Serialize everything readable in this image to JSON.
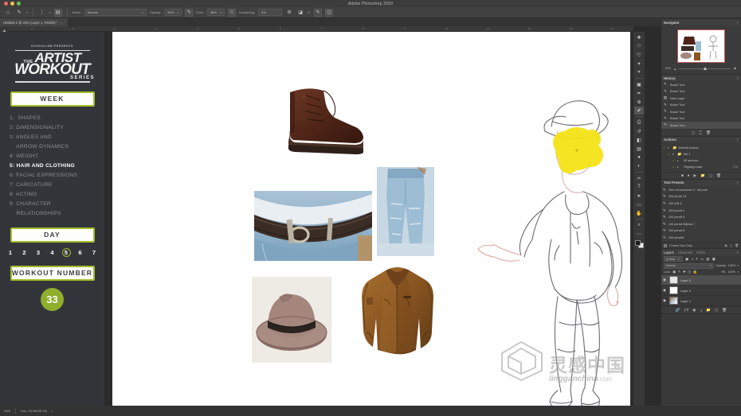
{
  "window": {
    "app_title": "Adobe Photoshop 2020",
    "traffic_lights": [
      "close",
      "minimize",
      "zoom"
    ]
  },
  "options_bar": {
    "home_icon": "home-icon",
    "tool_icon": "brush-tool-icon",
    "tool_caret": "▾",
    "brush_size_caret": "▾",
    "toggle_brush_panel": "brush-panel-icon",
    "mode_label": "Mode:",
    "mode_value": "Normal",
    "mode_caret": "▾",
    "opacity_label": "Opacity:",
    "opacity_value": "50%",
    "opacity_caret": "▾",
    "pressure_opacity_icon": "pressure-opacity-icon",
    "flow_label": "Flow:",
    "flow_value": "38%",
    "flow_caret": "▾",
    "airbrush_icon": "airbrush-icon",
    "smoothing_label": "Smoothing:",
    "smoothing_value": "0%",
    "smoothing_gear": "gear-icon",
    "angle_icon": "brush-angle-icon",
    "angle_value": "0°",
    "symmetry_icon": "symmetry-icon",
    "pressure_size_icon": "pressure-size-icon",
    "tablet_icon": "tablet-pressure-icon"
  },
  "document_tab": {
    "label": "Untitled-1 @ 33% (Layer 1, RGB/8) *",
    "close": "×"
  },
  "rulers": {
    "horizontal_ticks": [
      "0",
      "1",
      "2",
      "3",
      "4",
      "5",
      "6",
      "7",
      "8",
      "9",
      "10",
      "11",
      "12",
      "13",
      "14"
    ],
    "vertical_ticks": [
      "0",
      "1",
      "2",
      "3",
      "4",
      "5",
      "6",
      "7",
      "8"
    ]
  },
  "left_toolbar": {
    "items": [
      {
        "name": "move-tool",
        "glyph": "✚",
        "selected": false
      },
      {
        "name": "marquee-tool",
        "glyph": "□",
        "selected": false
      },
      {
        "name": "lasso-tool",
        "glyph": "➰",
        "selected": false
      },
      {
        "name": "quick-select-tool",
        "glyph": "✦",
        "selected": false
      },
      {
        "name": "crop-tool",
        "glyph": "⌗",
        "selected": false
      },
      {
        "name": "eyedropper-tool",
        "glyph": "✒",
        "selected": false
      },
      {
        "name": "healing-brush-tool",
        "glyph": "⊕",
        "selected": false
      },
      {
        "name": "brush-tool",
        "glyph": "✐",
        "selected": true
      },
      {
        "name": "clone-stamp-tool",
        "glyph": "⎙",
        "selected": false
      },
      {
        "name": "history-brush-tool",
        "glyph": "↺",
        "selected": false
      },
      {
        "name": "eraser-tool",
        "glyph": "◧",
        "selected": false
      },
      {
        "name": "gradient-tool",
        "glyph": "▤",
        "selected": false
      },
      {
        "name": "blur-tool",
        "glyph": "●",
        "selected": false
      },
      {
        "name": "dodge-tool",
        "glyph": "◐",
        "selected": false
      },
      {
        "name": "pen-tool",
        "glyph": "✑",
        "selected": false
      },
      {
        "name": "type-tool",
        "glyph": "T",
        "selected": false
      },
      {
        "name": "path-select-tool",
        "glyph": "➤",
        "selected": false
      },
      {
        "name": "shape-tool",
        "glyph": "▭",
        "selected": false
      },
      {
        "name": "hand-tool",
        "glyph": "✋",
        "selected": false
      },
      {
        "name": "zoom-tool",
        "glyph": "⌕",
        "selected": false
      }
    ]
  },
  "right_toolbar": {
    "items": [
      {
        "name": "move-tool",
        "glyph": "✚",
        "selected": false
      },
      {
        "name": "marquee-tool",
        "glyph": "□",
        "selected": false
      },
      {
        "name": "lasso-tool",
        "glyph": "➰",
        "selected": false
      },
      {
        "name": "quick-select-tool",
        "glyph": "✦",
        "selected": false
      },
      {
        "name": "crop-tool",
        "glyph": "⌗",
        "selected": false
      },
      {
        "name": "frame-tool",
        "glyph": "▣",
        "selected": false
      },
      {
        "name": "eyedropper-tool",
        "glyph": "✒",
        "selected": false
      },
      {
        "name": "healing-brush-tool",
        "glyph": "⊕",
        "selected": false
      },
      {
        "name": "brush-tool",
        "glyph": "✐",
        "selected": true
      },
      {
        "name": "clone-stamp-tool",
        "glyph": "⎙",
        "selected": false
      },
      {
        "name": "history-brush-tool",
        "glyph": "↺",
        "selected": false
      },
      {
        "name": "eraser-tool",
        "glyph": "◧",
        "selected": false
      },
      {
        "name": "gradient-tool",
        "glyph": "▤",
        "selected": false
      },
      {
        "name": "blur-tool",
        "glyph": "●",
        "selected": false
      },
      {
        "name": "dodge-tool",
        "glyph": "◐",
        "selected": false
      },
      {
        "name": "pen-tool",
        "glyph": "✑",
        "selected": false
      },
      {
        "name": "type-tool",
        "glyph": "T",
        "selected": false
      },
      {
        "name": "path-select-tool",
        "glyph": "➤",
        "selected": false
      },
      {
        "name": "shape-tool",
        "glyph": "▭",
        "selected": false
      },
      {
        "name": "hand-tool",
        "glyph": "✋",
        "selected": false
      },
      {
        "name": "zoom-tool",
        "glyph": "⌕",
        "selected": false
      },
      {
        "name": "edit-toolbar",
        "glyph": "⋯",
        "selected": false
      }
    ],
    "foreground_color": "#1a1a1a",
    "background_color": "#f2f2f2"
  },
  "poster": {
    "presents_text": "SCHOOLISM       PRESENTS",
    "logo_the": "THE",
    "logo_artist": "ARTIST",
    "logo_workout": "WORKOUT",
    "logo_series": "SERIES",
    "week_button": "WEEK",
    "week_items": [
      {
        "label": "1:  SHAPES",
        "active": false
      },
      {
        "label": "2: DIMENSIONALITY",
        "active": false
      },
      {
        "label": "3: ANGLES AND",
        "active": false
      },
      {
        "label": "    ARROW DYNAMICS",
        "active": false
      },
      {
        "label": "4: WEIGHT",
        "active": false
      },
      {
        "label": "5: HAIR AND CLOTHING",
        "active": true
      },
      {
        "label": "6: FACIAL EXPRESSIONS",
        "active": false
      },
      {
        "label": "7: CARICATURE",
        "active": false
      },
      {
        "label": "8: ACTING",
        "active": false
      },
      {
        "label": "9: CHARACTER",
        "active": false
      },
      {
        "label": "    RELATIONSHIPS",
        "active": false
      }
    ],
    "day_button": "DAY",
    "days": [
      "1",
      "2",
      "3",
      "4",
      "5",
      "6",
      "7"
    ],
    "selected_day": "5",
    "workout_button": "WORKOUT NUMBER",
    "workout_number": "33",
    "accent_color": "#9fbd2a",
    "background_color": "#32363a"
  },
  "canvas": {
    "reference_photos": [
      {
        "name": "reference-photo-boot",
        "subject": "brown leather ankle boot"
      },
      {
        "name": "reference-photo-belt",
        "subject": "leather belt on blue jeans"
      },
      {
        "name": "reference-photo-jeans",
        "subject": "ripped light blue jeans"
      },
      {
        "name": "reference-photo-hat",
        "subject": "brown fedora hat"
      },
      {
        "name": "reference-photo-jacket",
        "subject": "brown leather jacket"
      }
    ],
    "sketch": {
      "name": "character-sketch",
      "subject": "pencil sketch of man in fedora and jacket"
    },
    "watermark_cn": "灵感中国",
    "watermark_en": "lingganchina",
    "watermark_tld": ".com"
  },
  "navigator": {
    "title": "Navigator",
    "zoom_value": "33%",
    "menu_icon": "≡"
  },
  "history": {
    "title": "History",
    "menu_icon": "≡",
    "items": [
      {
        "label": "Brush Tool",
        "icon": "brush-icon",
        "selected": false
      },
      {
        "label": "Brush Tool",
        "icon": "brush-icon",
        "selected": false
      },
      {
        "label": "New Layer",
        "icon": "layer-icon",
        "selected": false
      },
      {
        "label": "Brush Tool",
        "icon": "brush-icon",
        "selected": false
      },
      {
        "label": "Brush Tool",
        "icon": "brush-icon",
        "selected": false
      },
      {
        "label": "Brush Tool",
        "icon": "brush-icon",
        "selected": false
      },
      {
        "label": "Brush Tool",
        "icon": "brush-icon",
        "selected": true
      }
    ],
    "footer_icons": [
      "snapshot-icon",
      "new-document-icon",
      "delete-icon"
    ]
  },
  "actions": {
    "title": "Actions",
    "menu_icon": "≡",
    "items": [
      {
        "label": "Default Actions",
        "key": "",
        "icon": "folder-icon",
        "depth": 0
      },
      {
        "label": "Set 1",
        "key": "",
        "icon": "folder-icon",
        "depth": 1
      },
      {
        "label": "90 sec/min",
        "key": "",
        "icon": "action-icon",
        "depth": 2
      },
      {
        "label": "Flipping mask",
        "key": "F10",
        "icon": "action-icon",
        "depth": 2
      }
    ],
    "footer_icons": [
      "stop-icon",
      "record-icon",
      "play-icon",
      "folder-icon",
      "new-action-icon",
      "delete-icon"
    ]
  },
  "tool_presets": {
    "title": "Tool Presets",
    "menu_icon": "≡",
    "items": [
      {
        "label": "100 x brush/circle 3  - 48 pure",
        "icon": "brush-icon"
      },
      {
        "label": "100 pencil 14",
        "icon": "brush-icon"
      },
      {
        "label": "100 A/B 5",
        "icon": "brush-icon"
      },
      {
        "label": "100 pencil x",
        "icon": "brush-icon"
      },
      {
        "label": "100 pencil 6",
        "icon": "brush-icon"
      },
      {
        "label": "100 pencil Billows 7",
        "icon": "brush-icon"
      },
      {
        "label": "100 pencil 8",
        "icon": "brush-icon"
      },
      {
        "label": "100 pencil6",
        "icon": "brush-icon"
      }
    ],
    "current_tool_only": "Current Tool Only",
    "footer_icons": [
      "list-view-icon",
      "new-preset-icon",
      "delete-icon"
    ]
  },
  "layers": {
    "tabs": [
      {
        "label": "Layers",
        "active": true
      },
      {
        "label": "Channels",
        "active": false
      },
      {
        "label": "Paths",
        "active": false
      }
    ],
    "menu_icon": "≡",
    "filter_kind": "Q Kind",
    "filter_caret": "▾",
    "filter_icons": [
      "pixel-filter-icon",
      "adjustment-filter-icon",
      "type-filter-icon",
      "shape-filter-icon",
      "smart-filter-icon"
    ],
    "blend_mode": "Normal",
    "blend_caret": "▾",
    "opacity_label": "Opacity:",
    "opacity_value": "100%",
    "lock_label": "Lock:",
    "lock_icons": [
      "lock-transparency-icon",
      "lock-image-icon",
      "lock-position-icon",
      "lock-artboard-icon",
      "lock-all-icon"
    ],
    "fill_label": "Fill:",
    "fill_value": "100%",
    "rows": [
      {
        "name": "Layer 3",
        "visible": true,
        "selected": true,
        "thumb": "checker"
      },
      {
        "name": "Layer 2",
        "visible": true,
        "selected": false,
        "thumb": "white"
      },
      {
        "name": "Layer 1",
        "visible": true,
        "selected": false,
        "thumb": "image"
      }
    ],
    "footer_icons": [
      "link-icon",
      "fx-icon",
      "mask-icon",
      "adjustment-icon",
      "group-icon",
      "new-layer-icon",
      "delete-icon"
    ]
  },
  "status_bar": {
    "zoom": "33%",
    "doc_info": "Doc: 20.3M/45.7M",
    "caret": "▸"
  }
}
